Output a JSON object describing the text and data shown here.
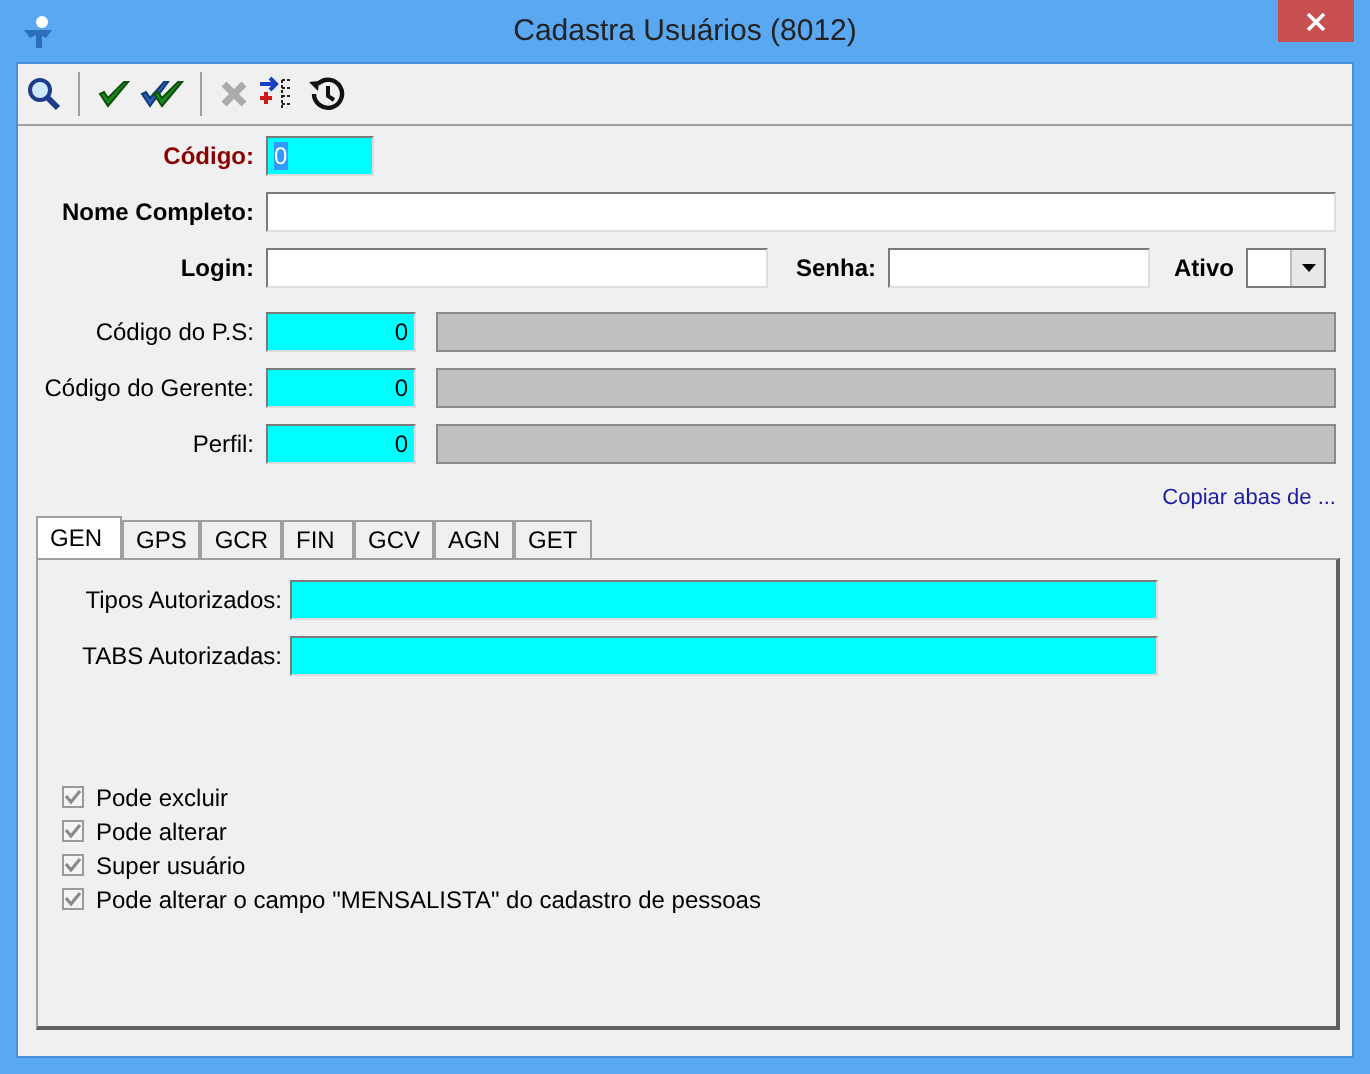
{
  "window": {
    "title": "Cadastra Usuários (8012)"
  },
  "toolbar": [
    {
      "kind": "search",
      "disabled": false
    },
    {
      "kind": "separator"
    },
    {
      "kind": "check",
      "disabled": false
    },
    {
      "kind": "double-check",
      "disabled": false
    },
    {
      "kind": "separator"
    },
    {
      "kind": "delete",
      "disabled": true
    },
    {
      "kind": "transfer",
      "disabled": false
    },
    {
      "kind": "history",
      "disabled": false
    }
  ],
  "form": {
    "codigo": {
      "label": "Código:",
      "value": "0"
    },
    "nome_completo": {
      "label": "Nome Completo:"
    },
    "login": {
      "label": "Login:"
    },
    "senha": {
      "label": "Senha:"
    },
    "ativo": {
      "label": "Ativo"
    },
    "lookups": [
      {
        "label": "Código do P.S:",
        "value": "0"
      },
      {
        "label": "Código do Gerente:",
        "value": "0"
      },
      {
        "label": "Perfil:",
        "value": "0"
      }
    ]
  },
  "copy_link": "Copiar abas de ...",
  "tabs": [
    {
      "label": "GEN",
      "selected": true
    },
    {
      "label": "GPS",
      "selected": false
    },
    {
      "label": "GCR",
      "selected": false
    },
    {
      "label": "FIN",
      "selected": false
    },
    {
      "label": "GCV",
      "selected": false
    },
    {
      "label": "AGN",
      "selected": false
    },
    {
      "label": "GET",
      "selected": false
    }
  ],
  "tab_panel": {
    "fields": [
      {
        "label": "Tipos Autorizados:"
      },
      {
        "label": "TABS Autorizadas:"
      }
    ],
    "checkboxes": [
      {
        "label": "Pode excluir",
        "checked": true,
        "disabled": true
      },
      {
        "label": "Pode alterar",
        "checked": true,
        "disabled": true
      },
      {
        "label": "Super usuário",
        "checked": true,
        "disabled": true
      },
      {
        "label": "Pode alterar o campo \"MENSALISTA\" do cadastro de pessoas",
        "checked": true,
        "disabled": true
      }
    ]
  }
}
